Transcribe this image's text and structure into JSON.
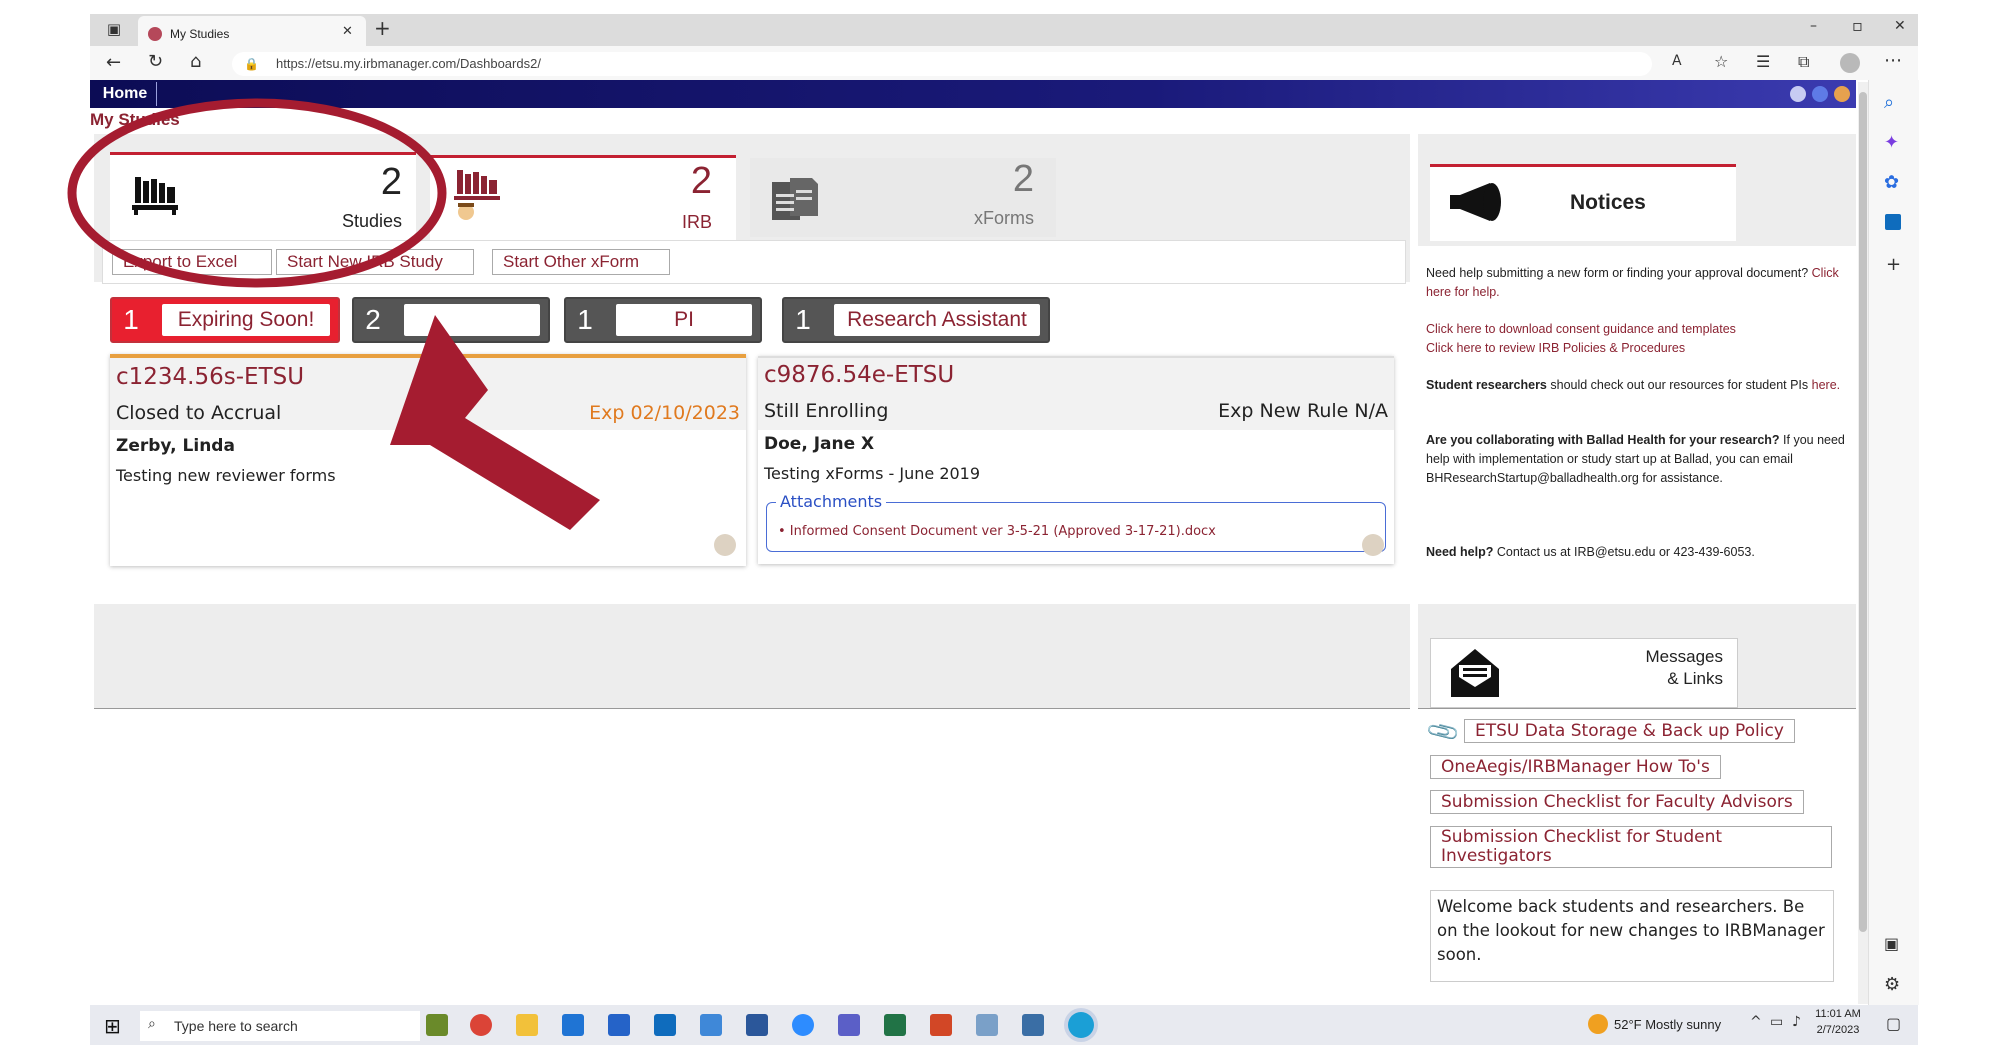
{
  "browser": {
    "tab_title": "My Studies",
    "url": "https://etsu.my.irbmanager.com/Dashboards2/",
    "new_tab": "+",
    "win_min": "–",
    "win_max": "▫",
    "win_close": "✕",
    "tab_close": "✕"
  },
  "nav": {
    "home": "Home",
    "breadcrumb": "My Studies"
  },
  "tiles": [
    {
      "count": "2",
      "label": "Studies"
    },
    {
      "count": "2",
      "label": "IRB"
    },
    {
      "count": "2",
      "label": "xForms"
    }
  ],
  "actions": {
    "export": "Export to Excel",
    "start_irb": "Start New IRB Study",
    "start_other": "Start Other xForm"
  },
  "filters": [
    {
      "count": "1",
      "label": "Expiring Soon!"
    },
    {
      "count": "2",
      "label": ""
    },
    {
      "count": "1",
      "label": "PI"
    },
    {
      "count": "1",
      "label": "Research Assistant"
    }
  ],
  "studies": [
    {
      "id": "c1234.56s-ETSU",
      "status": "Closed to Accrual",
      "exp": "Exp 02/10/2023",
      "person": "Zerby, Linda",
      "title": "Testing new reviewer forms"
    },
    {
      "id": "c9876.54e-ETSU",
      "status": "Still Enrolling",
      "exp": "Exp New Rule N/A",
      "person": "Doe, Jane X",
      "title": "Testing xForms - June 2019",
      "attachments_label": "Attachments",
      "attachment": "• Informed Consent Document ver 3-5-21 (Approved 3-17-21).docx"
    }
  ],
  "notices": {
    "title": "Notices",
    "p1_a": "Need help submitting a new form or finding your approval document?",
    "p1_link": "Click here for help.",
    "p2_a": "Click here to download consent guidance and templates",
    "p2_b": "Click here to review IRB Policies & Procedures",
    "p3_bold": "Student researchers",
    "p3_text": "should check out our resources for student PIs",
    "p3_link": "here.",
    "p4_bold": "Are you collaborating with Ballad Health for your research?",
    "p4_text": "If you need help with implementation or study start up at Ballad, you can email BHResearchStartup@balladhealth.org for assistance.",
    "p5_bold": "Need help?",
    "p5_text": "Contact us at IRB@etsu.edu or 423-439-6053."
  },
  "messages": {
    "title_line1": "Messages",
    "title_line2": "& Links",
    "links": [
      "ETSU Data Storage & Back up Policy",
      "OneAegis/IRBManager How To's",
      "Submission Checklist for Faculty Advisors",
      "Submission Checklist for Student Investigators"
    ],
    "welcome": "Welcome back students and researchers.  Be on the lookout for new changes to IRBManager soon."
  },
  "taskbar": {
    "search_placeholder": "Type here to search",
    "weather": "52°F  Mostly sunny",
    "time": "11:01 AM",
    "date": "2/7/2023"
  },
  "colors": {
    "brand": "#8b2332",
    "annotation": "#a51c30",
    "navbar": "#12126a"
  }
}
